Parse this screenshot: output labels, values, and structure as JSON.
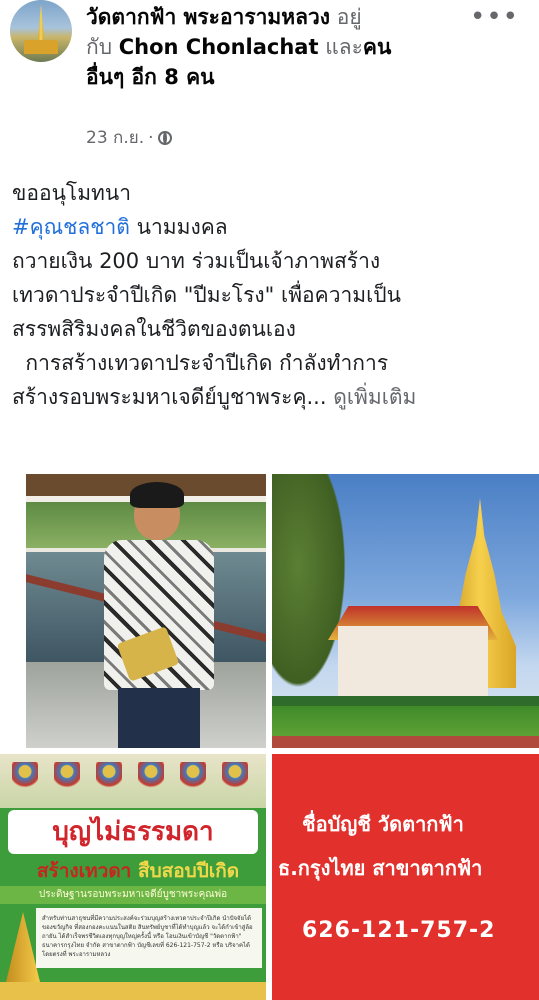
{
  "post": {
    "page_name": "วัดตากฟ้า พระอารามหลวง",
    "with_text_1": "อยู่",
    "with_text_2": "กับ",
    "tagged_user": "Chon Chonlachat",
    "and_text": "และ",
    "others_1": "คน",
    "others_2": "อื่นๆ อีก 8 คน",
    "date": "23 ก.ย.",
    "separator": "·",
    "privacy_icon": "globe-icon",
    "more_icon": "more-dots-icon",
    "more_label": "•••"
  },
  "body": {
    "line1": "ขออนุโมทนา",
    "hashtag": "#คุณชลชาติ",
    "line2_rest": " นามมงคล",
    "line3": "ถวายเงิน 200 บาท ร่วมเป็นเจ้าภาพสร้าง",
    "line4": "เทวดาประจำปีเกิด \"ปีมะโรง\" เพื่อความเป็น",
    "line5": "สรรพสิริมงคลในชีวิตของตนเอง",
    "line6": "  การสร้างเทวดาประจำปีเกิด กำลังทำการ",
    "line7": "สร้างรอบพระมหาเจดีย์บูชาพระคุ...",
    "see_more": "ดูเพิ่มเติม"
  },
  "poster_left": {
    "title": "บุญไม่ธรรมดา",
    "subtitle_a": "สร้างเทวดา",
    "subtitle_b": "สืบสอบปีเกิด",
    "stripe": "ประดิษฐานรอบพระมหาเจดีย์บูชาพระคุณพ่อ",
    "panel_text": "สำหรับท่านสาธุชนที่มีความประสงค์จะร่วมบุญสร้างเทวดาประจำปีเกิด นำปัจจัยได้ของขวัญกิจ ที่สองกองคะแนนในสติย สินทรัพย์บูชาที่ได้ทำบุญแล้ว จะได้กำเข้าสู่ล้อถายัน ได้สำเร็จพรชีวิตเองทุกบุญใหญ่ครั้งนี้ หรือ โอนเงินเข้าบัญชี \"วัดตากฟ้า\" ธนาคารกรุงไทย จำกัด สาขาตากฟ้า บัญชีเลขที่ 626-121-757-2 หรือ บริจาคได้โดยตรงที่ พระอารามหลวง"
  },
  "poster_right": {
    "line1": "ชื่อบัญชี วัดตากฟ้า",
    "line2": "ธ.กรุงไทย สาขาตากฟ้า",
    "account_number": "626-121-757-2"
  },
  "colors": {
    "link": "#216fdb",
    "secondary_text": "#65676b",
    "poster_red": "#e2302d",
    "poster_green": "#3c9d3a"
  }
}
